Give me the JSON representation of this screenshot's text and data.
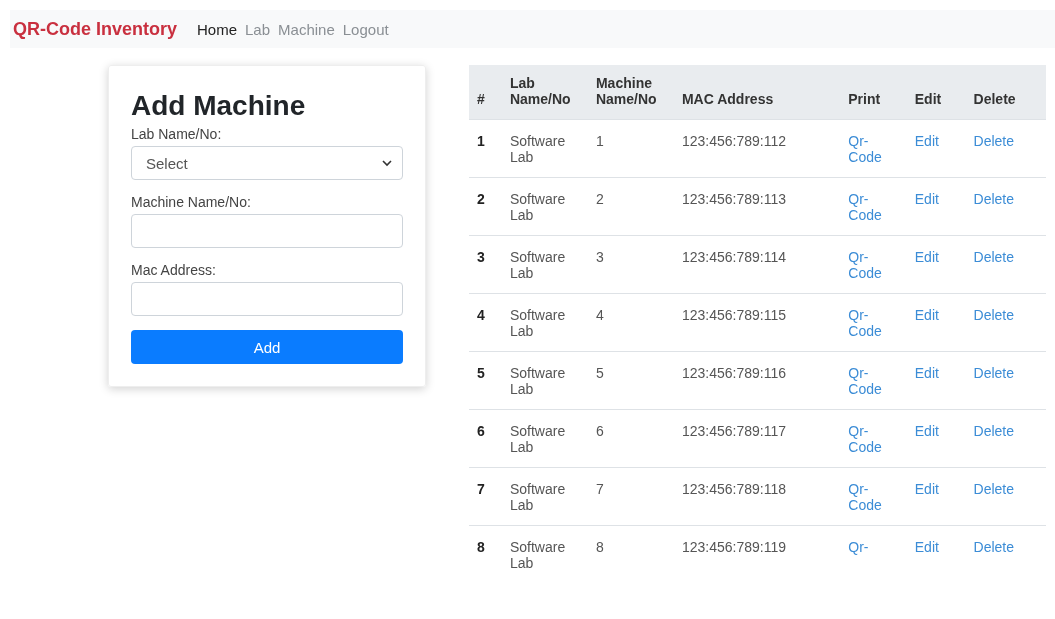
{
  "navbar": {
    "brand": "QR-Code Inventory",
    "links": [
      {
        "label": "Home",
        "selected": true
      },
      {
        "label": "Lab",
        "selected": false
      },
      {
        "label": "Machine",
        "selected": false
      },
      {
        "label": "Logout",
        "selected": false
      }
    ]
  },
  "form": {
    "title": "Add Machine",
    "fields": [
      {
        "kind": "select",
        "label": "Lab Name/No:",
        "value": "Select"
      },
      {
        "kind": "text",
        "label": "Machine Name/No:"
      },
      {
        "kind": "text",
        "label": "Mac Address:"
      }
    ],
    "submit": "Add"
  },
  "table": {
    "columns": [
      "#",
      "Lab Name/No",
      "Machine Name/No",
      "MAC Address",
      "Print",
      "Edit",
      "Delete"
    ],
    "rows": [
      {
        "number": "1",
        "lab": "Software Lab",
        "machine": "1",
        "mac": "123:456:789:112",
        "print": "Qr-Code",
        "edit": "Edit",
        "delete": "Delete"
      },
      {
        "number": "2",
        "lab": "Software Lab",
        "machine": "2",
        "mac": "123:456:789:113",
        "print": "Qr-Code",
        "edit": "Edit",
        "delete": "Delete"
      },
      {
        "number": "3",
        "lab": "Software Lab",
        "machine": "3",
        "mac": "123:456:789:114",
        "print": "Qr-Code",
        "edit": "Edit",
        "delete": "Delete"
      },
      {
        "number": "4",
        "lab": "Software Lab",
        "machine": "4",
        "mac": "123:456:789:115",
        "print": "Qr-Code",
        "edit": "Edit",
        "delete": "Delete"
      },
      {
        "number": "5",
        "lab": "Software Lab",
        "machine": "5",
        "mac": "123:456:789:116",
        "print": "Qr-Code",
        "edit": "Edit",
        "delete": "Delete"
      },
      {
        "number": "6",
        "lab": "Software Lab",
        "machine": "6",
        "mac": "123:456:789:117",
        "print": "Qr-Code",
        "edit": "Edit",
        "delete": "Delete"
      },
      {
        "number": "7",
        "lab": "Software Lab",
        "machine": "7",
        "mac": "123:456:789:118",
        "print": "Qr-Code",
        "edit": "Edit",
        "delete": "Delete"
      },
      {
        "number": "8",
        "lab": "Software Lab",
        "machine": "8",
        "mac": "123:456:789:119",
        "print": "Qr-",
        "edit": "Edit",
        "delete": "Delete"
      }
    ]
  }
}
